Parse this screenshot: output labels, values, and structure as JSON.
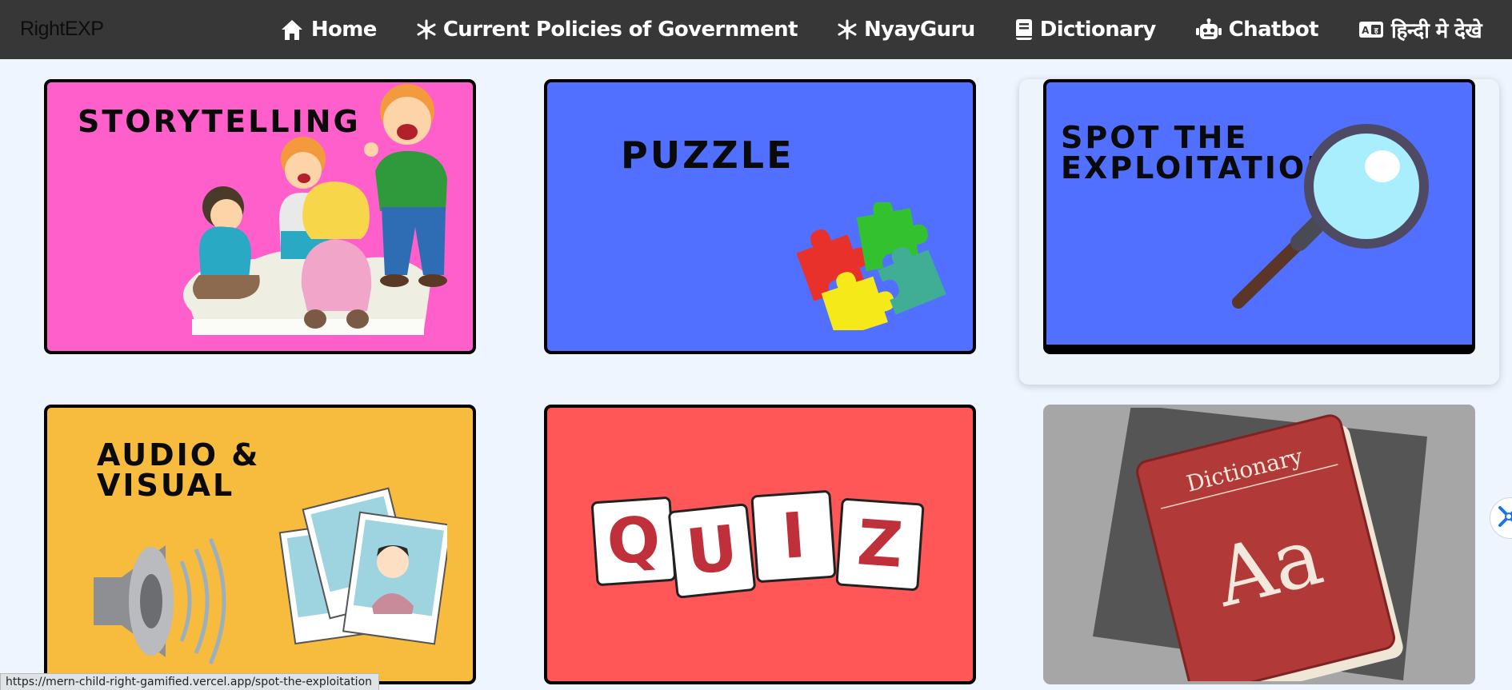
{
  "brand": "RightEXP",
  "nav": [
    {
      "label": "Home",
      "icon": "home-icon"
    },
    {
      "label": "Current Policies of Government",
      "icon": "snowflake-icon"
    },
    {
      "label": "NyayGuru",
      "icon": "snowflake-icon"
    },
    {
      "label": "Dictionary",
      "icon": "book-icon"
    },
    {
      "label": "Chatbot",
      "icon": "robot-icon"
    },
    {
      "label": "हिन्दी मे देखे",
      "icon": "language-icon"
    }
  ],
  "cards": {
    "storytelling": {
      "title": "STORYTELLING",
      "bg": "#ff5fcb"
    },
    "puzzle": {
      "title": "PUZZLE",
      "bg": "#5170ff"
    },
    "spot": {
      "title_line1": "SPOT THE",
      "title_line2": "EXPLOITATION",
      "bg": "#5170ff"
    },
    "audio": {
      "title_line1": "AUDIO &",
      "title_line2": "VISUAL",
      "bg": "#f7bb3d"
    },
    "quiz": {
      "letters": [
        "Q",
        "U",
        "I",
        "Z"
      ],
      "bg": "#ff5757"
    },
    "dictionary": {
      "book_title": "Dictionary",
      "book_letters": "Aa",
      "bg": "#a6a6a6"
    }
  },
  "status_url": "https://mern-child-right-gamified.vercel.app/spot-the-exploitation",
  "colors": {
    "navbar": "#373737",
    "page_bg": "#eef5ff",
    "accent_widget": "#1a73e8"
  }
}
